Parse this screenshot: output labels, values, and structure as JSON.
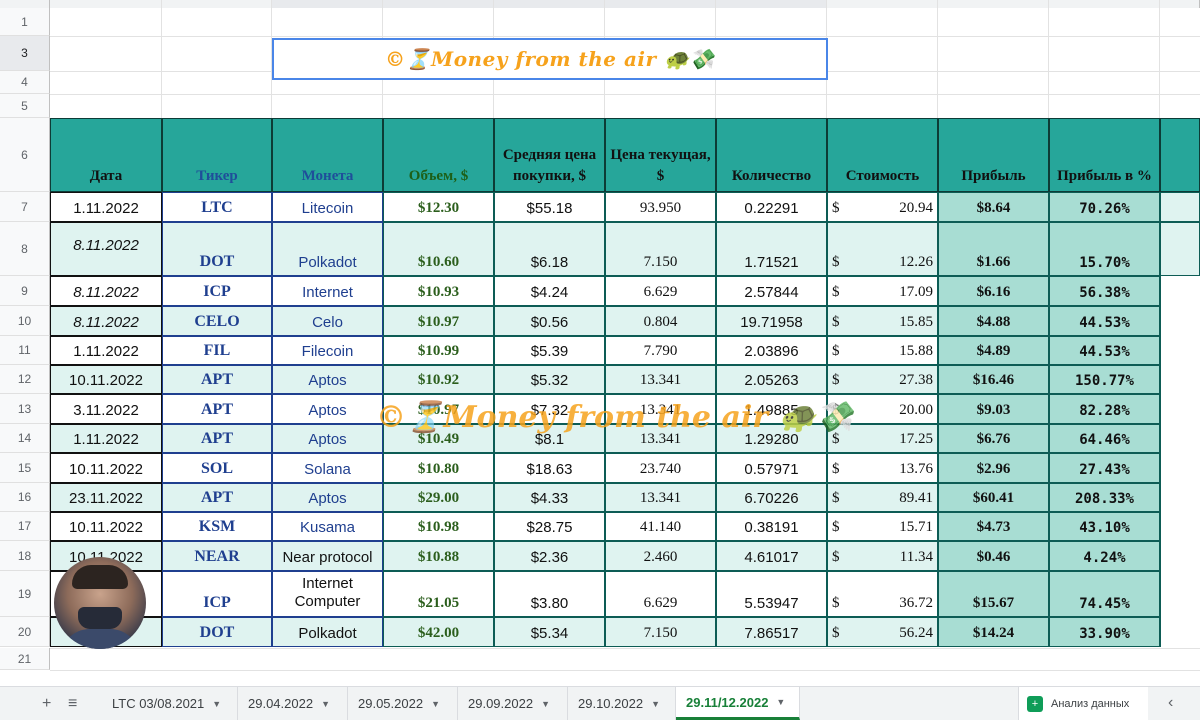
{
  "title": "©⏳Money from the air 🐢💸",
  "watermark": "©⏳Money from the air 🐢💸",
  "headers": {
    "date": "Дата",
    "ticker": "Тикер",
    "coin": "Монета",
    "volume": "Объем, $",
    "avg_price": "Средняя цена покупки, $",
    "cur_price": "Цена текущая, $",
    "qty": "Количество",
    "value": "Стоимость",
    "profit": "Прибыль",
    "profit_pct": "Прибыль в %"
  },
  "rows": [
    {
      "num": "7",
      "date": "1.11.2022",
      "ticker": "LTC",
      "coin": "Litecoin",
      "volume": "$12.30",
      "avg": "$55.18",
      "cur": "93.950",
      "qty": "0.22291",
      "value": "20.94",
      "profit": "$8.64",
      "pct": "70.26%"
    },
    {
      "num": "8",
      "date": "8.11.2022",
      "ticker": "DOT",
      "coin": "Polkadot",
      "volume": "$10.60",
      "avg": "$6.18",
      "cur": "7.150",
      "qty": "1.71521",
      "value": "12.26",
      "profit": "$1.66",
      "pct": "15.70%"
    },
    {
      "num": "9",
      "date": "8.11.2022",
      "ticker": "ICP",
      "coin": "Internet",
      "volume": "$10.93",
      "avg": "$4.24",
      "cur": "6.629",
      "qty": "2.57844",
      "value": "17.09",
      "profit": "$6.16",
      "pct": "56.38%"
    },
    {
      "num": "10",
      "date": "8.11.2022",
      "ticker": "CELO",
      "coin": "Celo",
      "volume": "$10.97",
      "avg": "$0.56",
      "cur": "0.804",
      "qty": "19.71958",
      "value": "15.85",
      "profit": "$4.88",
      "pct": "44.53%"
    },
    {
      "num": "11",
      "date": "1.11.2022",
      "ticker": "FIL",
      "coin": "Filecoin",
      "volume": "$10.99",
      "avg": "$5.39",
      "cur": "7.790",
      "qty": "2.03896",
      "value": "15.88",
      "profit": "$4.89",
      "pct": "44.53%"
    },
    {
      "num": "12",
      "date": "10.11.2022",
      "ticker": "APT",
      "coin": "Aptos",
      "volume": "$10.92",
      "avg": "$5.32",
      "cur": "13.341",
      "qty": "2.05263",
      "value": "27.38",
      "profit": "$16.46",
      "pct": "150.77%"
    },
    {
      "num": "13",
      "date": "3.11.2022",
      "ticker": "APT",
      "coin": "Aptos",
      "volume": "$10.97",
      "avg": "$7.32",
      "cur": "13.341",
      "qty": "1.49885",
      "value": "20.00",
      "profit": "$9.03",
      "pct": "82.28%"
    },
    {
      "num": "14",
      "date": "1.11.2022",
      "ticker": "APT",
      "coin": "Aptos",
      "volume": "$10.49",
      "avg": "$8.1",
      "cur": "13.341",
      "qty": "1.29280",
      "value": "17.25",
      "profit": "$6.76",
      "pct": "64.46%"
    },
    {
      "num": "15",
      "date": "10.11.2022",
      "ticker": "SOL",
      "coin": "Solana",
      "volume": "$10.80",
      "avg": "$18.63",
      "cur": "23.740",
      "qty": "0.57971",
      "value": "13.76",
      "profit": "$2.96",
      "pct": "27.43%"
    },
    {
      "num": "16",
      "date": "23.11.2022",
      "ticker": "APT",
      "coin": "Aptos",
      "volume": "$29.00",
      "avg": "$4.33",
      "cur": "13.341",
      "qty": "6.70226",
      "value": "89.41",
      "profit": "$60.41",
      "pct": "208.33%"
    },
    {
      "num": "17",
      "date": "10.11.2022",
      "ticker": "KSM",
      "coin": "Kusama",
      "volume": "$10.98",
      "avg": "$28.75",
      "cur": "41.140",
      "qty": "0.38191",
      "value": "15.71",
      "profit": "$4.73",
      "pct": "43.10%"
    },
    {
      "num": "18",
      "date": "10.11.2022",
      "ticker": "NEAR",
      "coin": "Near protocol",
      "volume": "$10.88",
      "avg": "$2.36",
      "cur": "2.460",
      "qty": "4.61017",
      "value": "11.34",
      "profit": "$0.46",
      "pct": "4.24%"
    },
    {
      "num": "19",
      "date": "",
      "ticker": "ICP",
      "coin": "Internet Computer",
      "volume": "$21.05",
      "avg": "$3.80",
      "cur": "6.629",
      "qty": "5.53947",
      "value": "36.72",
      "profit": "$15.67",
      "pct": "74.45%"
    },
    {
      "num": "20",
      "date": "2",
      "ticker": "DOT",
      "coin": "Polkadot",
      "volume": "$42.00",
      "avg": "$5.34",
      "cur": "7.150",
      "qty": "7.86517",
      "value": "56.24",
      "profit": "$14.24",
      "pct": "33.90%"
    }
  ],
  "currency_symbol": "$",
  "row_numbers": [
    "1",
    "3",
    "4",
    "5",
    "6",
    "21"
  ],
  "tabs": [
    {
      "label": "LTC 03/08.2021"
    },
    {
      "label": "29.04.2022"
    },
    {
      "label": "29.05.2022"
    },
    {
      "label": "29.09.2022"
    },
    {
      "label": "29.10.2022"
    },
    {
      "label": "29.11/12.2022"
    }
  ],
  "active_tab": "29.11/12.2022",
  "add_sheet": "+",
  "all_sheets": "≡",
  "explore_label": "Анализ данных",
  "explore_icon": "+",
  "collapse": "‹",
  "colors": {
    "header_teal": "#26a69a",
    "accent_green": "#188038",
    "title_orange": "#f6a21c",
    "ticker_blue": "#1f3f8f"
  }
}
